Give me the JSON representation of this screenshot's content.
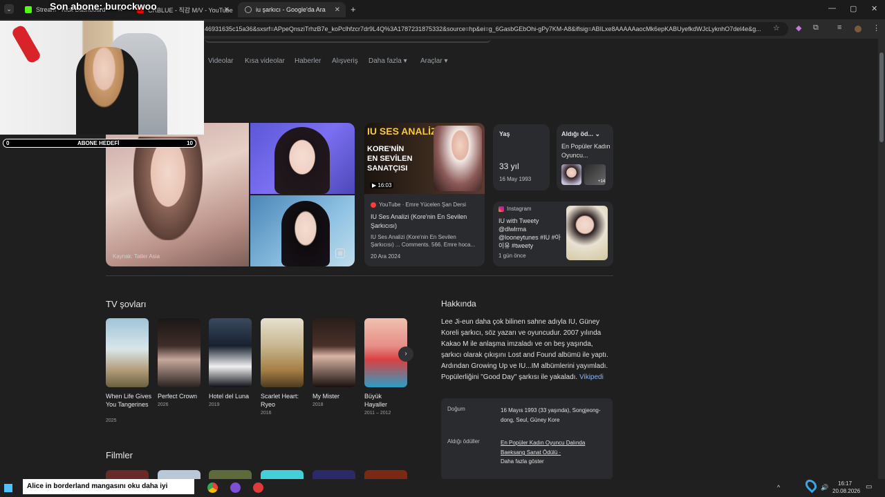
{
  "browser": {
    "tabs": [
      {
        "label": "Stream - Kick Dashboard",
        "active": false
      },
      {
        "label": "CRBLUE - 직감 M/V - YouTube",
        "active": false
      },
      {
        "label": "iu şarkıcı - Google'da Ara",
        "active": true
      }
    ],
    "new_tab": "+",
    "url": "46931635c15a36&sxsrf=APpeQnsziTrhzB7e_koPclhfzcr7dr9L4Q%3A1787231875332&source=hp&ei=g_6GasbGEbOhi-gPy7KM-A8&iflsig=ABILxe8AAAAAaocMk6epKABUyefkdWJcLyknhO7del4e&g...",
    "window_controls": [
      "—",
      "▢",
      "✕"
    ]
  },
  "search_nav": [
    "Videolar",
    "Kısa videolar",
    "Haberler",
    "Alışveriş",
    "Daha fazla ▾",
    "Araçlar ▾"
  ],
  "image_source": "Kaynak: Tatler Asia",
  "video_card": {
    "thumb_title": "IU SES ANALİZİ",
    "thumb_sub1": "KORE'NİN",
    "thumb_sub2": "EN SEVİLEN",
    "thumb_sub3": "SANATÇISI",
    "duration": "16:03",
    "source": "YouTube · Emre Yücelen Şan Dersi",
    "title": "IU Ses Analizi (Kore'nin En Sevilen Şarkıcısı)",
    "snippet": "IU Ses Analizi (Kore'nin En Sevilen Şarkıcısı) ... Comments. 566. Emre hoca...",
    "date": "20 Ara 2024"
  },
  "age_card": {
    "label": "Yaş",
    "value": "33 yıl",
    "date": "16 May 1993"
  },
  "award_card": {
    "label": "Aldığı öd...",
    "text": "En Popüler Kadın Oyuncu...",
    "more": "+14"
  },
  "instagram_card": {
    "source": "Instagram",
    "text": "IU with Tweety @dlwlrma @looneytunes #IU #아이유 #tweety",
    "time": "1 gün önce"
  },
  "tv_section": {
    "title": "TV şovları",
    "items": [
      {
        "title": "When Life Gives You Tangerines",
        "year": "2025"
      },
      {
        "title": "Perfect Crown",
        "year": "2026"
      },
      {
        "title": "Hotel del Luna",
        "year": "2019"
      },
      {
        "title": "Scarlet Heart: Ryeo",
        "year": "2016"
      },
      {
        "title": "My Mister",
        "year": "2018"
      },
      {
        "title": "Büyük Hayaller",
        "year": "2011 – 2012"
      }
    ]
  },
  "films_section": {
    "title": "Filmler"
  },
  "about": {
    "title": "Hakkında",
    "text": "Lee Ji-eun daha çok bilinen sahne adıyla IU, Güney Koreli şarkıcı, söz yazarı ve oyuncudur. 2007 yılında Kakao M ile anlaşma imzaladı ve on beş yaşında, şarkıcı olarak çıkışını Lost and Found albümü ile yaptı. Ardından Growing Up ve IU...IM albümlerini yayımladı. Popülerliğini \"Good Day\" şarkısı ile yakaladı.",
    "link": "Vikipedi",
    "born_label": "Doğum",
    "born_value": "16 Mayıs 1993 (33 yaşında), Songjeong-dong, Seul, Güney Kore",
    "awards_label": "Aldığı ödüller",
    "awards_value": "En Popüler Kadın Oyuncu Dalında Baeksang Sanat Ödülü ·",
    "awards_more": "Daha fazla göster"
  },
  "stream": {
    "title": "Son abone: burockwoo",
    "goal_label": "ABONE HEDEFİ",
    "goal_start": "0",
    "goal_end": "10",
    "ticker": "Alice in borderland mangasını oku daha iyi"
  },
  "taskbar": {
    "time": "16:17",
    "date": "20.08.2026"
  },
  "colors": {
    "page_bg": "#1f1f1f",
    "card_bg": "#2a2b2e",
    "link": "#8ab4f8"
  }
}
